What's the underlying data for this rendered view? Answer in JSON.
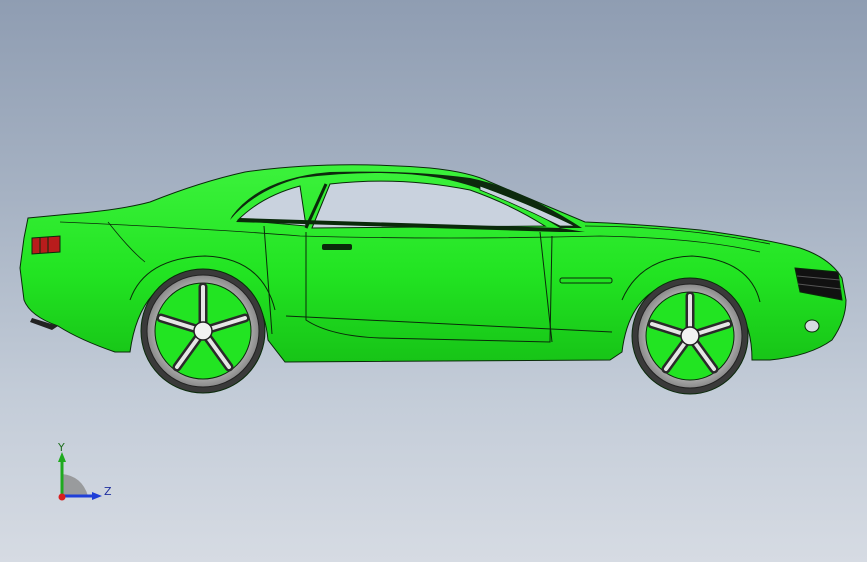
{
  "viewport": {
    "background_top": "#8f9db2",
    "background_bottom": "#d6dbe3"
  },
  "model": {
    "body_color": "#22ee22",
    "edge_color": "#0a2a0a",
    "glass_color": "#c9d2de",
    "wheel_color": "#b5b5b5",
    "tire_color": "#3a3a3a",
    "taillight_color": "#b81c1c"
  },
  "triad": {
    "y_label": "Y",
    "z_label": "Z",
    "y_color": "#1faa1f",
    "z_color": "#1f3fd8",
    "origin_color": "#d81f1f"
  }
}
